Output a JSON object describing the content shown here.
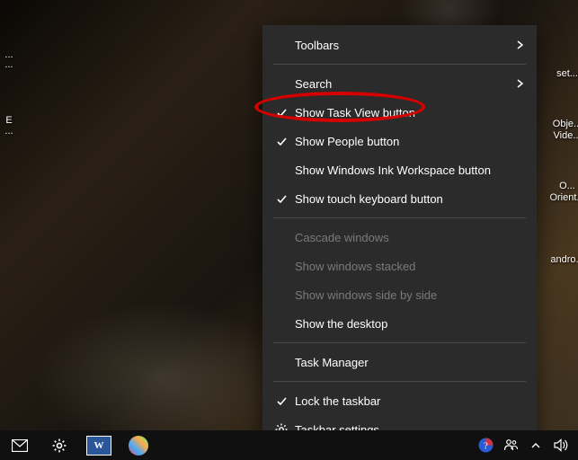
{
  "desktop": {
    "icons": {
      "a": "...",
      "b": "...",
      "c": "E",
      "d": "...",
      "e": "set...",
      "f": "Obje...",
      "g": "Vide...",
      "h": "O...",
      "i": "Orient...",
      "j": "andro..."
    }
  },
  "menu": {
    "toolbars": "Toolbars",
    "search": "Search",
    "show_task_view": "Show Task View button",
    "show_people": "Show People button",
    "show_ink": "Show Windows Ink Workspace button",
    "show_touch_kb": "Show touch keyboard button",
    "cascade": "Cascade windows",
    "stacked": "Show windows stacked",
    "side_by_side": "Show windows side by side",
    "show_desktop": "Show the desktop",
    "task_manager": "Task Manager",
    "lock_taskbar": "Lock the taskbar",
    "taskbar_settings": "Taskbar settings"
  },
  "icons": {
    "check": "check-icon",
    "gear": "gear-icon",
    "chevron": "chevron-right-icon"
  },
  "taskbar": {
    "start": "start-icon",
    "mail": "mail-icon",
    "settings": "settings-icon",
    "word": "W",
    "paint": "paint-icon",
    "help": "help-icon",
    "people": "people-icon",
    "tray_up": "tray-up-icon",
    "volume": "volume-icon"
  }
}
